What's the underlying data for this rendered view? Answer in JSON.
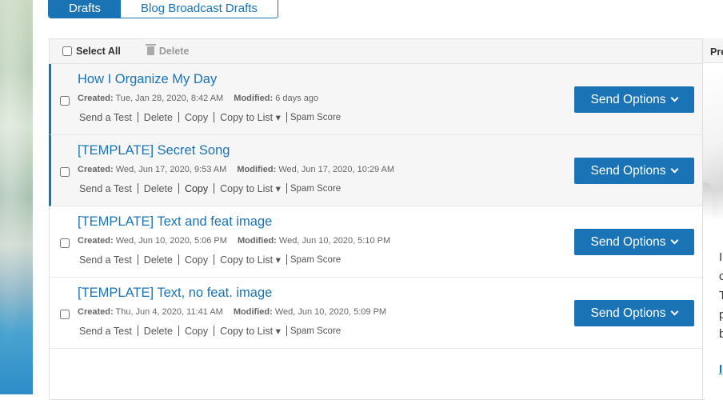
{
  "tabs": [
    "Drafts",
    "Blog Broadcast Drafts"
  ],
  "list_header": {
    "select_all": "Select All",
    "delete": "Delete"
  },
  "row_actions": [
    "Send a Test",
    "Delete",
    "Copy",
    "Copy to List ▾",
    "Spam Score"
  ],
  "send_options_label": "Send Options",
  "created_label": "Created:",
  "modified_label": "Modified:",
  "drafts": [
    {
      "title": "How I Organize My Day",
      "created": "Tue, Jan 28, 2020, 8:42 AM",
      "modified": "6 days ago",
      "highlighted": true
    },
    {
      "title": "[TEMPLATE] Secret Song",
      "created": "Wed, Jun 17, 2020, 9:53 AM",
      "modified": "Wed, Jun 17, 2020, 10:29 AM",
      "highlighted": true
    },
    {
      "title": "[TEMPLATE] Text and feat image",
      "created": "Wed, Jun 10, 2020, 5:06 PM",
      "modified": "Wed, Jun 10, 2020, 5:10 PM",
      "highlighted": false
    },
    {
      "title": "[TEMPLATE] Text, no feat. image",
      "created": "Thu, Jun 4, 2020, 11:41 AM",
      "modified": "Wed, Jun 10, 2020, 5:09 PM",
      "highlighted": false
    }
  ],
  "preview": {
    "header": "Pre",
    "text_lines": [
      "I",
      "c",
      "T",
      "p",
      "b"
    ],
    "link": "I"
  },
  "colors": {
    "accent": "#1a73b5",
    "header_bg": "#f5f5f5"
  }
}
